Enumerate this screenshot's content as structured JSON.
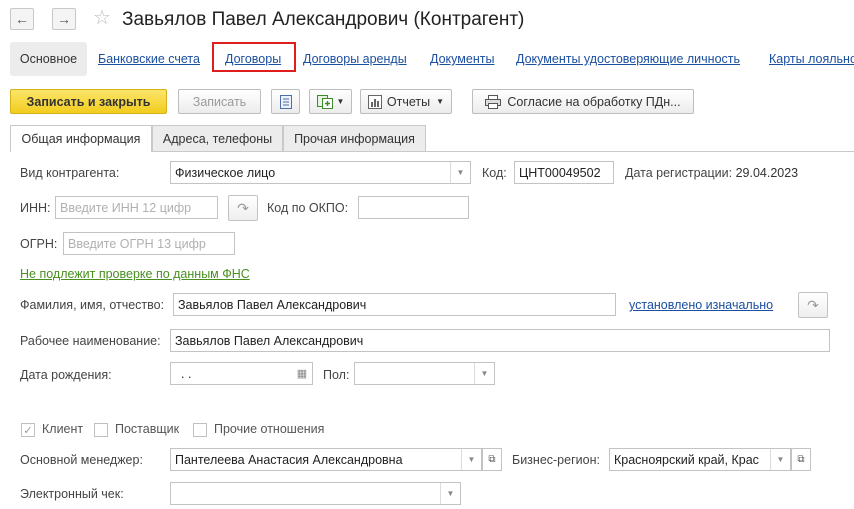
{
  "window": {
    "title": "Завьялов Павел Александрович (Контрагент)",
    "back_icon": "←",
    "forward_icon": "→",
    "favorite_icon": "☆"
  },
  "sections": {
    "active": "Основное",
    "links": [
      "Банковские счета",
      "Договоры",
      "Договоры аренды",
      "Документы",
      "Документы удостоверяющие личность",
      "Карты лояльно"
    ]
  },
  "toolbar": {
    "save_close": "Записать и закрыть",
    "save": "Записать",
    "reports": "Отчеты",
    "consent": "Согласие на обработку ПДн..."
  },
  "tabs": [
    "Общая информация",
    "Адреса, телефоны",
    "Прочая информация"
  ],
  "form": {
    "type_label": "Вид контрагента:",
    "type_value": "Физическое лицо",
    "code_label": "Код:",
    "code_value": "ЦНТ00049502",
    "reg_date_label": "Дата регистрации:",
    "reg_date_value": "29.04.2023",
    "inn_label": "ИНН:",
    "inn_placeholder": "Введите ИНН 12 цифр",
    "okpo_label": "Код по ОКПО:",
    "ogrn_label": "ОГРН:",
    "ogrn_placeholder": "Введите ОГРН 13 цифр",
    "fns_link": "Не подлежит проверке по данным ФНС",
    "fio_label": "Фамилия, имя, отчество:",
    "fio_value": "Завьялов Павел Александрович",
    "fio_status_link": "установлено изначально",
    "work_name_label": "Рабочее наименование:",
    "work_name_value": "Завьялов Павел Александрович",
    "birth_label": "Дата рождения:",
    "birth_value": " .  .",
    "gender_label": "Пол:",
    "client_label": "Клиент",
    "supplier_label": "Поставщик",
    "other_label": "Прочие отношения",
    "manager_label": "Основной менеджер:",
    "manager_value": "Пантелеева Анастасия Александровна",
    "region_label": "Бизнес-регион:",
    "region_value": "Красноярский край, Крас",
    "echeck_label": "Электронный чек:"
  },
  "colors": {
    "accent_yellow": "#f2cd1e",
    "link_blue": "#1b4fa0",
    "highlight_red": "#e01d1d",
    "fns_green": "#4a8f20"
  }
}
